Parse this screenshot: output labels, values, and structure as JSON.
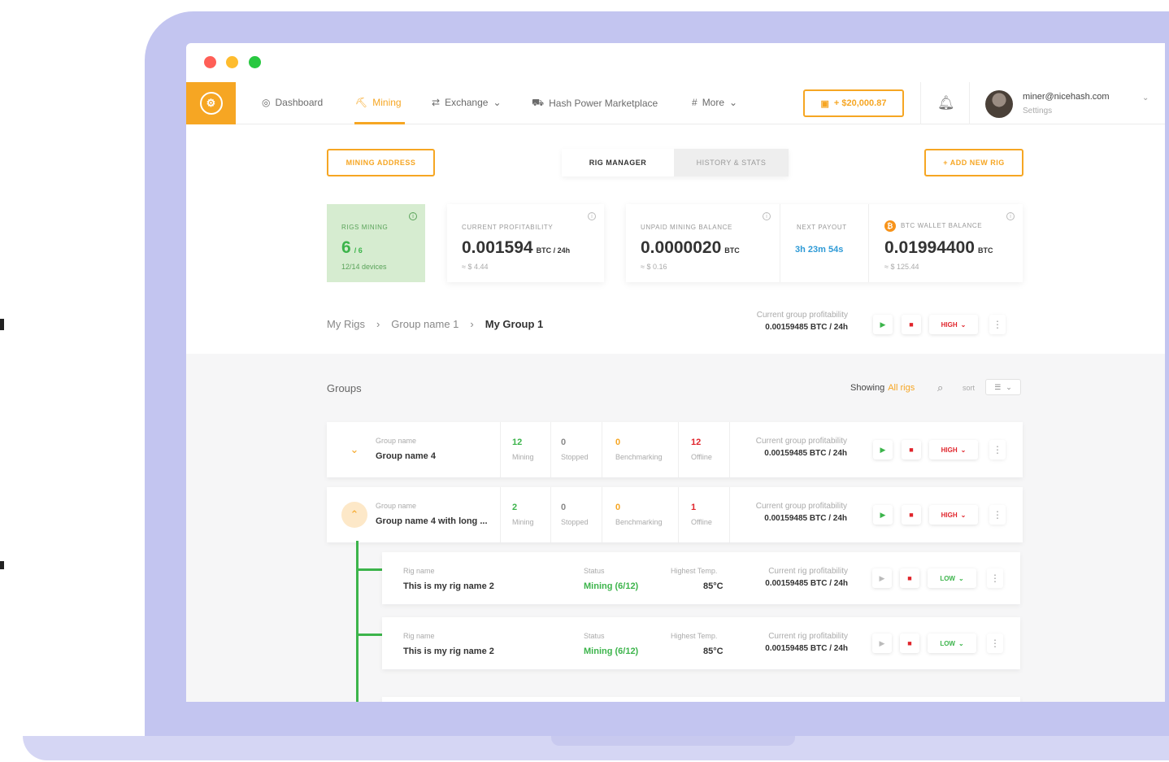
{
  "window": {
    "dots": [
      "#ff5f57",
      "#febc2e",
      "#28c840"
    ]
  },
  "nav": {
    "items": [
      {
        "icon": "dashboard-icon",
        "glyph": "◎",
        "label": "Dashboard"
      },
      {
        "icon": "mining-icon",
        "glyph": "⛏",
        "label": "Mining"
      },
      {
        "icon": "exchange-icon",
        "glyph": "⇄",
        "label": "Exchange",
        "dropdown": "⌄"
      },
      {
        "icon": "cart-icon",
        "glyph": "⛟",
        "label": "Hash Power Marketplace"
      },
      {
        "icon": "more-icon",
        "glyph": "#",
        "label": "More",
        "dropdown": "⌄"
      }
    ],
    "balance": "+ $20,000.87",
    "user": {
      "email": "miner@nicehash.com",
      "settings": "Settings"
    }
  },
  "toolbar": {
    "mining_address": "MINING ADDRESS",
    "tab_rig_manager": "RIG MANAGER",
    "tab_history": "HISTORY & STATS",
    "add_rig": "+ ADD NEW RIG"
  },
  "cards": {
    "rigs_mining": {
      "label": "RIGS MINING",
      "value": "6",
      "unit": "/ 6",
      "sub": "12/14 devices"
    },
    "profitability": {
      "label": "CURRENT PROFITABILITY",
      "value": "0.001594",
      "unit": "BTC / 24h",
      "sub": "≈ $ 4.44"
    },
    "unpaid": {
      "label": "UNPAID MINING BALANCE",
      "value": "0.0000020",
      "unit": "BTC",
      "sub": "≈ $ 0.16"
    },
    "next_payout": {
      "label": "NEXT PAYOUT",
      "value": "3h 23m 54s"
    },
    "wallet": {
      "label": "BTC WALLET BALANCE",
      "value": "0.01994400",
      "unit": "BTC",
      "sub": "≈ $ 125.44"
    }
  },
  "breadcrumb": {
    "root": "My Rigs",
    "mid": "Group name 1",
    "current": "My Group 1"
  },
  "group_profit": {
    "label": "Current group profitability",
    "value": "0.00159485 BTC / 24h"
  },
  "power": {
    "high": "HIGH",
    "low": "LOW"
  },
  "groups": {
    "title": "Groups",
    "showing": "Showing",
    "filter": "All rigs",
    "sort": "sort",
    "rows": [
      {
        "sub": "Group name",
        "name": "Group name 4",
        "mining": "12",
        "stopped": "0",
        "benchmarking": "0",
        "offline": "12"
      },
      {
        "sub": "Group name",
        "name": "Group name 4 with long ...",
        "mining": "2",
        "stopped": "0",
        "benchmarking": "0",
        "offline": "1"
      }
    ],
    "stat_labels": {
      "mining": "Mining",
      "stopped": "Stopped",
      "benchmarking": "Benchmarking",
      "offline": "Offline"
    }
  },
  "rigs": {
    "labels": {
      "name": "Rig name",
      "status": "Status",
      "temp": "Highest Temp.",
      "profit": "Current rig profitability"
    },
    "rows": [
      {
        "name": "This is my rig name 2",
        "status": "Mining (6/12)",
        "temp": "85°C",
        "profit": "0.00159485 BTC / 24h"
      },
      {
        "name": "This is my rig name 2",
        "status": "Mining (6/12)",
        "temp": "85°C",
        "profit": "0.00159485 BTC / 24h"
      }
    ]
  }
}
